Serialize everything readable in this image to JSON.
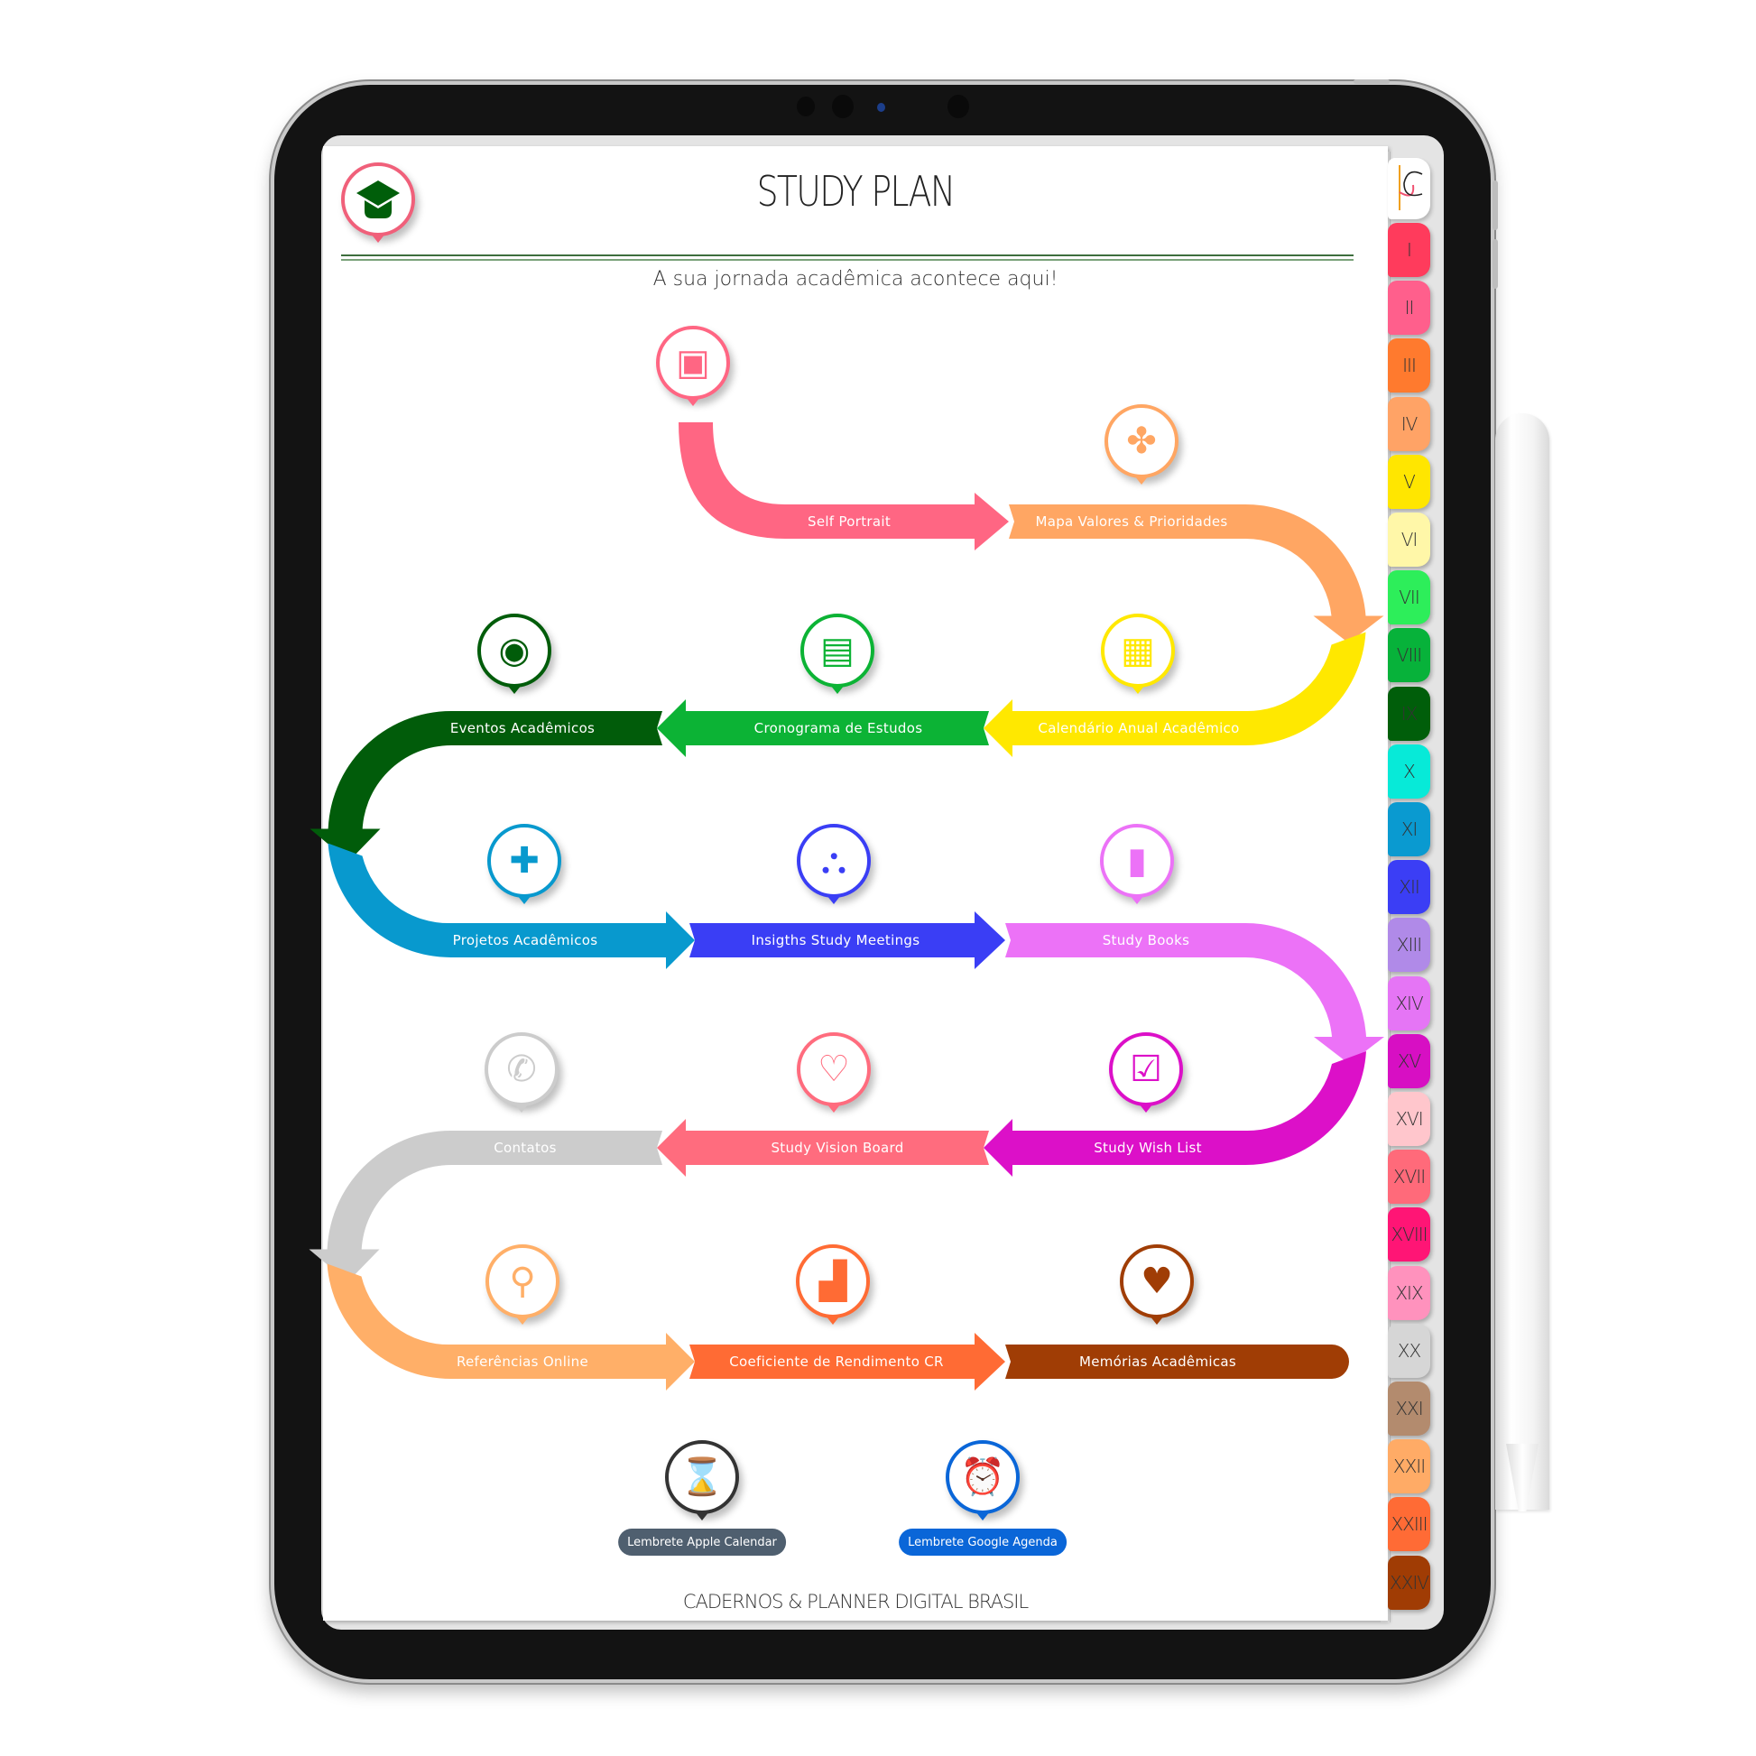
{
  "header": {
    "title": "STUDY PLAN",
    "subtitle": "A sua jornada acadêmica acontece aqui!",
    "home_icon": "graduation-cap-icon"
  },
  "footer": {
    "brand": "CADERNOS & PLANNER DIGITAL BRASIL"
  },
  "tabs": [
    {
      "label": "I",
      "color": "#ff3b5c"
    },
    {
      "label": "II",
      "color": "#ff5f8c"
    },
    {
      "label": "III",
      "color": "#ff7a2e"
    },
    {
      "label": "IV",
      "color": "#ffa366"
    },
    {
      "label": "V",
      "color": "#ffe600"
    },
    {
      "label": "VI",
      "color": "#fff7a8"
    },
    {
      "label": "VII",
      "color": "#2dee5a"
    },
    {
      "label": "VIII",
      "color": "#07b23a"
    },
    {
      "label": "IX",
      "color": "#005e0a"
    },
    {
      "label": "X",
      "color": "#07ead8"
    },
    {
      "label": "XI",
      "color": "#0a9ad0"
    },
    {
      "label": "XII",
      "color": "#3b3ef5"
    },
    {
      "label": "XIII",
      "color": "#b08ae8"
    },
    {
      "label": "XIV",
      "color": "#e575f5"
    },
    {
      "label": "XV",
      "color": "#d70fc3"
    },
    {
      "label": "XVI",
      "color": "#ffc6cc"
    },
    {
      "label": "XVII",
      "color": "#ff6a7a"
    },
    {
      "label": "XVIII",
      "color": "#ff1575"
    },
    {
      "label": "XIX",
      "color": "#ff92bd"
    },
    {
      "label": "XX",
      "color": "#d6d6d6"
    },
    {
      "label": "XXI",
      "color": "#b38b6e"
    },
    {
      "label": "XXII",
      "color": "#ffab66"
    },
    {
      "label": "XXIII",
      "color": "#ff6b35"
    },
    {
      "label": "XXIV",
      "color": "#a03c04"
    }
  ],
  "steps": [
    {
      "label": "Self Portrait",
      "color": "#ff6683",
      "icon": "portrait-book-icon",
      "glyph": "▣"
    },
    {
      "label": "Mapa Valores & Prioridades",
      "color": "#ffa663",
      "icon": "clover-icon",
      "glyph": "✤"
    },
    {
      "label": "Calendário Anual Acadêmico",
      "color": "#ffe800",
      "icon": "calendar-check-icon",
      "glyph": "▦"
    },
    {
      "label": "Cronograma de Estudos",
      "color": "#0cb335",
      "icon": "calendar-book-icon",
      "glyph": "▤"
    },
    {
      "label": "Eventos Acadêmicos",
      "color": "#015c0a",
      "icon": "location-pin-icon",
      "glyph": "◉"
    },
    {
      "label": "Projetos Acadêmicos",
      "color": "#0899ce",
      "icon": "puzzle-icon",
      "glyph": "✚"
    },
    {
      "label": "Insigths Study Meetings",
      "color": "#3a3ef5",
      "icon": "team-network-icon",
      "glyph": "⛬"
    },
    {
      "label": "Study Books",
      "color": "#ec72f7",
      "icon": "book-icon",
      "glyph": "▮"
    },
    {
      "label": "Study Wish List",
      "color": "#dc10c8",
      "icon": "checklist-icon",
      "glyph": "☑"
    },
    {
      "label": "Study Vision Board",
      "color": "#ff6c7e",
      "icon": "laptop-heart-icon",
      "glyph": "♡"
    },
    {
      "label": "Contatos",
      "color": "#cccccc",
      "icon": "phone-icon",
      "glyph": "✆"
    },
    {
      "label": "Referências Online",
      "color": "#ffaf68",
      "icon": "magnifier-icon",
      "glyph": "⚲"
    },
    {
      "label": "Coeficiente de Rendimento CR",
      "color": "#ff6b34",
      "icon": "bar-chart-growth-icon",
      "glyph": "▟"
    },
    {
      "label": "Memórias Acadêmicas",
      "color": "#a03d05",
      "icon": "graduation-heart-icon",
      "glyph": "♥"
    }
  ],
  "reminders": [
    {
      "label": "Lembrete Apple Calendar",
      "color": "#4f5f6f",
      "ring": "#333333",
      "icon": "hourglass-icon",
      "glyph": "⌛"
    },
    {
      "label": "Lembrete Google Agenda",
      "color": "#0a66d8",
      "ring": "#0a66d8",
      "icon": "alarm-clock-icon",
      "glyph": "⏰"
    }
  ],
  "colors": {
    "header_rule": "#3e6e3e",
    "home_ring": "#f0607a",
    "home_icon": "#005e0a"
  }
}
